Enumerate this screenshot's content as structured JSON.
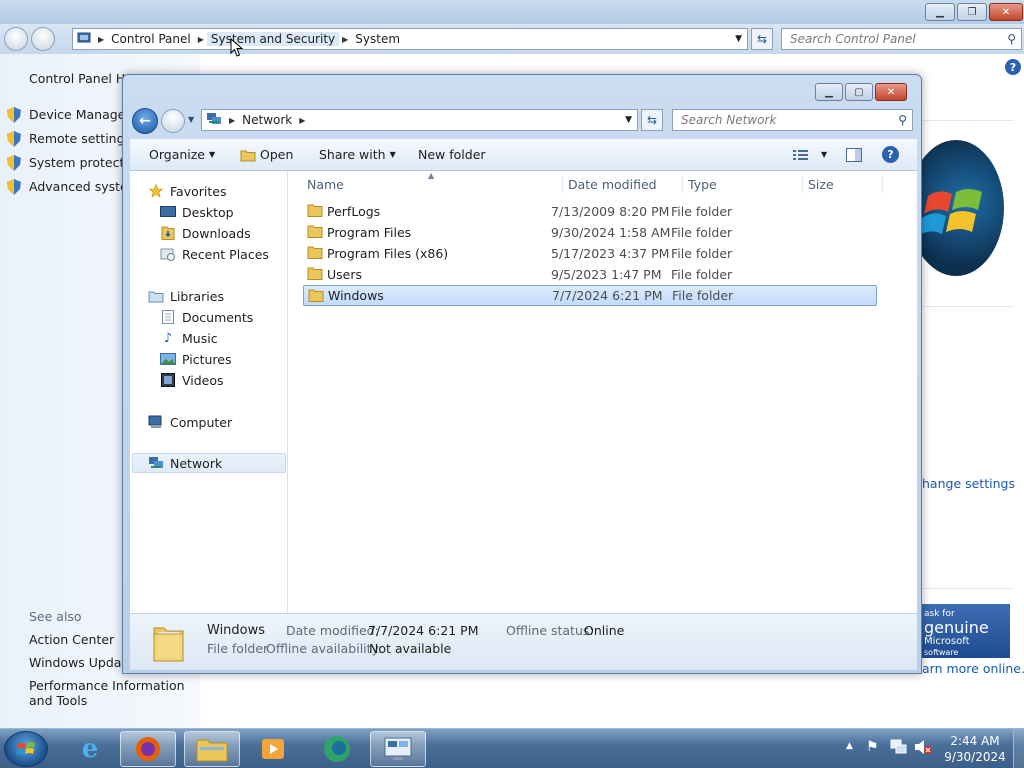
{
  "control_panel": {
    "breadcrumb": [
      "Control Panel",
      "System and Security",
      "System"
    ],
    "search_placeholder": "Search Control Panel",
    "left_home": "Control Panel Hor",
    "left_links": [
      "Device Manager",
      "Remote settings",
      "System protection",
      "Advanced system"
    ],
    "see_also_label": "See also",
    "see_also_links": [
      "Action Center",
      "Windows Update",
      "Performance Information and Tools"
    ],
    "change_settings": "hange settings",
    "learn_more": "arn more online...",
    "genuine_text": [
      "ask for",
      "genuine",
      "Microsoft",
      "software"
    ]
  },
  "explorer": {
    "breadcrumb": [
      "Network"
    ],
    "search_placeholder": "Search Network",
    "toolbar": {
      "organize": "Organize",
      "open": "Open",
      "share_with": "Share with",
      "new_folder": "New folder"
    },
    "nav": {
      "favorites": "Favorites",
      "favorites_items": [
        "Desktop",
        "Downloads",
        "Recent Places"
      ],
      "libraries": "Libraries",
      "libraries_items": [
        "Documents",
        "Music",
        "Pictures",
        "Videos"
      ],
      "computer": "Computer",
      "network": "Network"
    },
    "columns": {
      "name": "Name",
      "date": "Date modified",
      "type": "Type",
      "size": "Size"
    },
    "files": [
      {
        "name": "PerfLogs",
        "date": "7/13/2009 8:20 PM",
        "type": "File folder"
      },
      {
        "name": "Program Files",
        "date": "9/30/2024 1:58 AM",
        "type": "File folder"
      },
      {
        "name": "Program Files (x86)",
        "date": "5/17/2023 4:37 PM",
        "type": "File folder"
      },
      {
        "name": "Users",
        "date": "9/5/2023 1:47 PM",
        "type": "File folder"
      },
      {
        "name": "Windows",
        "date": "7/7/2024 6:21 PM",
        "type": "File folder"
      }
    ],
    "selected_index": 4,
    "details": {
      "name": "Windows",
      "type": "File folder",
      "date_label": "Date modified:",
      "date_value": "7/7/2024 6:21 PM",
      "offline_status_label": "Offline status:",
      "offline_status_value": "Online",
      "offline_avail_label": "Offline availability:",
      "offline_avail_value": "Not available"
    }
  },
  "taskbar": {
    "time": "2:44 AM",
    "date": "9/30/2024"
  },
  "colors": {
    "selection": "#c1dbfb",
    "link": "#1a57b5",
    "taskbar": "#4a6f99"
  }
}
